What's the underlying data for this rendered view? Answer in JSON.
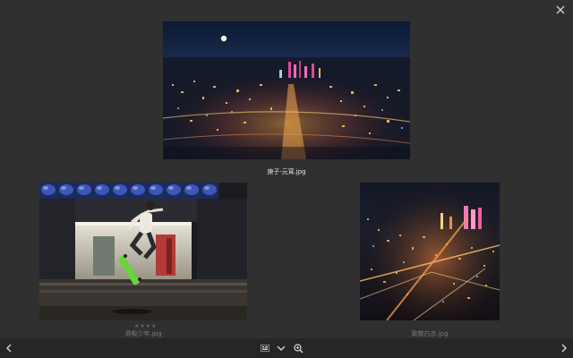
{
  "gallery": {
    "items": [
      {
        "filename": "庚子·元宵.jpg",
        "state": "current"
      },
      {
        "filename": "滑板少年.jpg",
        "state": "dimmed",
        "rating_stars": "★★★★"
      },
      {
        "filename": "致敬白衣.jpg",
        "state": "dimmed"
      }
    ]
  },
  "icons": {
    "close": "close-icon",
    "prev": "chevron-left-icon",
    "next": "chevron-right-icon",
    "grid": "grid-view-icon",
    "dropdown": "chevron-down-icon",
    "zoom": "zoom-in-icon"
  },
  "colors": {
    "background": "#303030",
    "toolbar": "#262626",
    "caption_active": "#e8e8e8",
    "caption_dim": "#7c7c7c"
  }
}
